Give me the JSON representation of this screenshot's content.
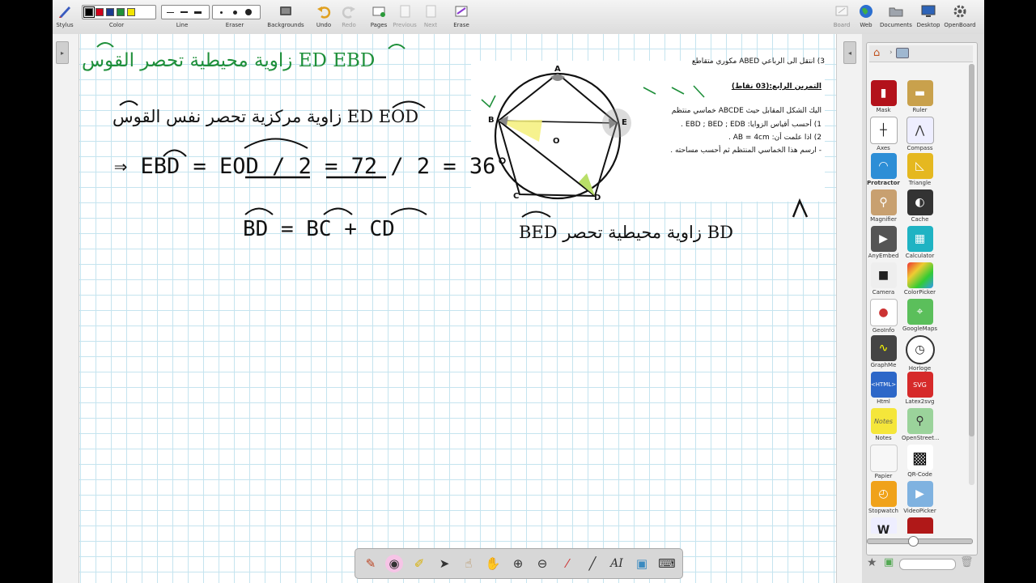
{
  "toolbar": {
    "stylus_label": "Stylus",
    "color_label": "Color",
    "line_label": "Line",
    "eraser_label": "Eraser",
    "backgrounds_label": "Backgrounds",
    "undo_label": "Undo",
    "redo_label": "Redo",
    "pages_label": "Pages",
    "previous_label": "Previous",
    "next_label": "Next",
    "erase_label": "Erase",
    "board_label": "Board",
    "web_label": "Web",
    "documents_label": "Documents",
    "desktop_label": "Desktop",
    "openboard_label": "OpenBoard",
    "colors": [
      "#000000",
      "#d0021b",
      "#1a3a8f",
      "#1e8f3a",
      "#f2e400"
    ],
    "selected_color": "#000000"
  },
  "handwriting": {
    "line1": "زاوية محيطية تحصر القوس ED    EBD",
    "line2": "زاوية مركزية تحصر نفس القوس ED    EOD",
    "equation": "⇒ EBD = EOD / 2 = 72 / 2 = 36°",
    "arc_sum": "BD = BC + CD",
    "inscribed": "BED زاوية محيطية تحصر BD"
  },
  "worksheet": {
    "top_text": "3) انتقل الى الرباعي ABED مكوري متقاطع",
    "exercise_title": "التمرين الرابع:(03 نقاط)",
    "line1": "اليك الشكل المقابل حيث ABCDE خماسي منتظم",
    "line2": "1) أحسب أقياس الزوايا: EBD ; BED ; EDB .",
    "line3": "2) اذا علمت أن: AB = 4cm .",
    "line4": "- ارسم هذا الخماسي المنتظم ثم أحسب مساحته .",
    "point_labels": [
      "A",
      "B",
      "C",
      "D",
      "E",
      "O"
    ]
  },
  "library": {
    "items": [
      "Mask",
      "Ruler",
      "Axes",
      "Compass",
      "Protractor",
      "Triangle",
      "Magnifier",
      "Cache",
      "AnyEmbed",
      "Calculator",
      "Camera",
      "ColorPicker",
      "GeoInfo",
      "GoogleMaps",
      "GraphMe",
      "Horloge",
      "Html",
      "Latex2svg",
      "Notes",
      "OpenStreet...",
      "Papier",
      "QR-Code",
      "Stopwatch",
      "VideoPicker",
      "W",
      ""
    ],
    "html_badge": "<HTML>",
    "notes_badge": "Notes",
    "svg_badge": "SVG"
  },
  "bottom_tools": [
    "pen",
    "eraser",
    "marker",
    "select",
    "interact",
    "hand",
    "zoom-in",
    "zoom-out",
    "laser",
    "line",
    "text",
    "capture",
    "keyboard"
  ],
  "text_tool_label": "AI"
}
